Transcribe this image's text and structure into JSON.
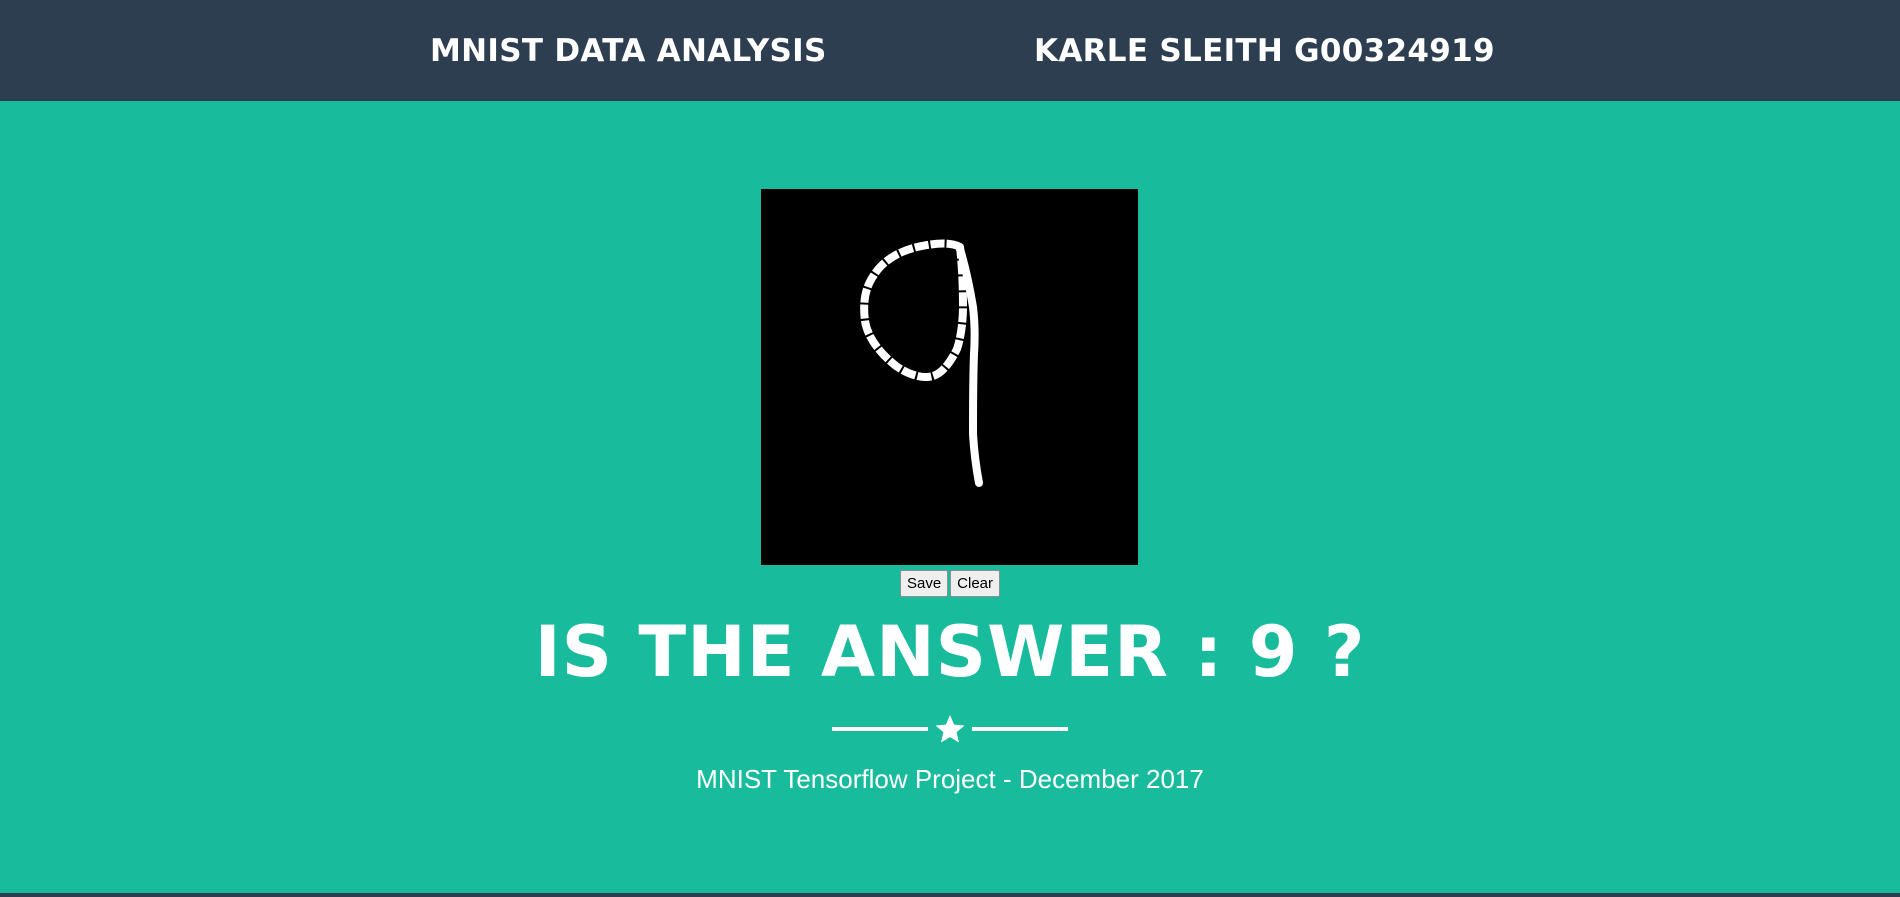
{
  "navbar": {
    "brand": "MNIST DATA ANALYSIS",
    "author": "KARLE SLEITH G00324919"
  },
  "canvas": {
    "background_color": "#000000",
    "stroke_color": "#ffffff"
  },
  "buttons": {
    "save_label": "Save",
    "clear_label": "Clear"
  },
  "result": {
    "answer_text": "IS THE ANSWER : 9 ?"
  },
  "divider": {
    "icon": "star-icon"
  },
  "footer": {
    "subtitle": "MNIST Tensorflow Project - December 2017"
  },
  "colors": {
    "navbar": "#2c3e50",
    "background": "#18bc9c",
    "text": "#ffffff"
  }
}
